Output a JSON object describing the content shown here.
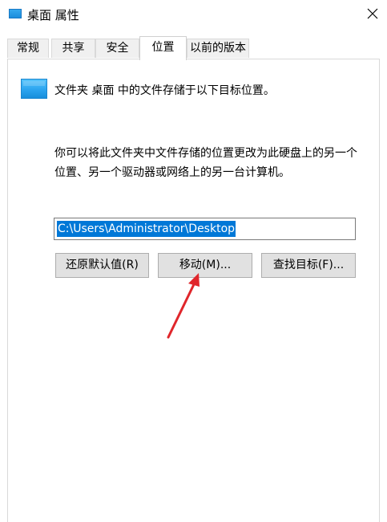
{
  "window": {
    "title": "桌面 属性",
    "icon": "desktop-folder-icon",
    "close_icon": "close-icon"
  },
  "tabs": [
    {
      "label": "常规",
      "active": false
    },
    {
      "label": "共享",
      "active": false
    },
    {
      "label": "安全",
      "active": false
    },
    {
      "label": "位置",
      "active": true
    },
    {
      "label": "以前的版本",
      "active": false
    }
  ],
  "location": {
    "header_text": "文件夹 桌面 中的文件存储于以下目标位置。",
    "description_line1": "你可以将此文件夹中文件存储的位置更改为此硬盘上的另一个",
    "description_line2": "位置、另一个驱动器或网络上的另一台计算机。",
    "path_value": "C:\\Users\\Administrator\\Desktop",
    "buttons": {
      "restore_default": "还原默认值(R)",
      "move": "移动(M)...",
      "find_target": "查找目标(F)..."
    }
  },
  "colors": {
    "selection": "#0078d7",
    "folder_blue": "#2ba4ef",
    "annotation_arrow": "#e0262b",
    "button_face": "#e1e1e1"
  }
}
